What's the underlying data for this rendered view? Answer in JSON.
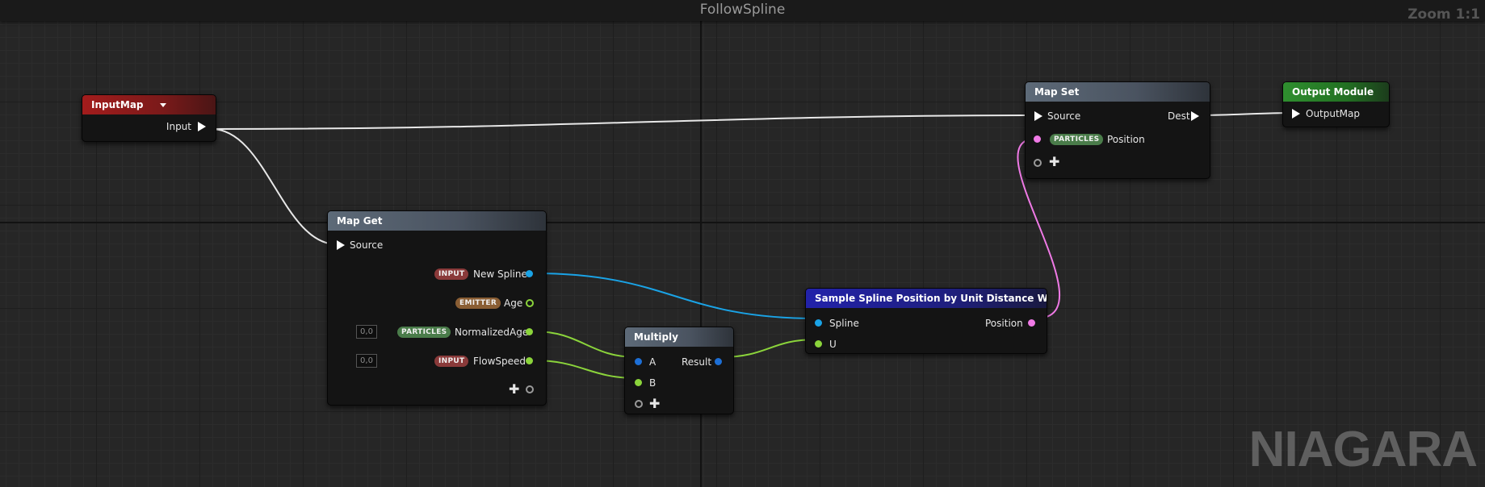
{
  "graph": {
    "title": "FollowSpline",
    "zoom": "Zoom 1:1",
    "watermark": "NIAGARA"
  },
  "nodes": {
    "input_map": {
      "title": "InputMap",
      "output_label": "Input"
    },
    "map_get": {
      "title": "Map Get",
      "source_label": "Source",
      "outputs": [
        {
          "tag": "INPUT",
          "label": "New Spline"
        },
        {
          "tag": "EMITTER",
          "label": "Age"
        },
        {
          "tag": "PARTICLES",
          "label": "NormalizedAge",
          "default": "0,0"
        },
        {
          "tag": "INPUT",
          "label": "FlowSpeed",
          "default": "0,0"
        }
      ]
    },
    "multiply": {
      "title": "Multiply",
      "input_a": "A",
      "input_b": "B",
      "output": "Result"
    },
    "sample_spline": {
      "title": "Sample Spline Position by Unit Distance WS",
      "input_spline": "Spline",
      "input_u": "U",
      "output": "Position"
    },
    "map_set": {
      "title": "Map Set",
      "source_label": "Source",
      "dest_label": "Dest",
      "param_tag": "PARTICLES",
      "param_label": "Position"
    },
    "output_module": {
      "title": "Output Module",
      "input_label": "OutputMap"
    }
  },
  "colors": {
    "exec_wire": "#e8e8e8",
    "spline_wire": "#1aa3e6",
    "float_wire": "#8bd43b",
    "position_wire": "#f07ae6"
  }
}
